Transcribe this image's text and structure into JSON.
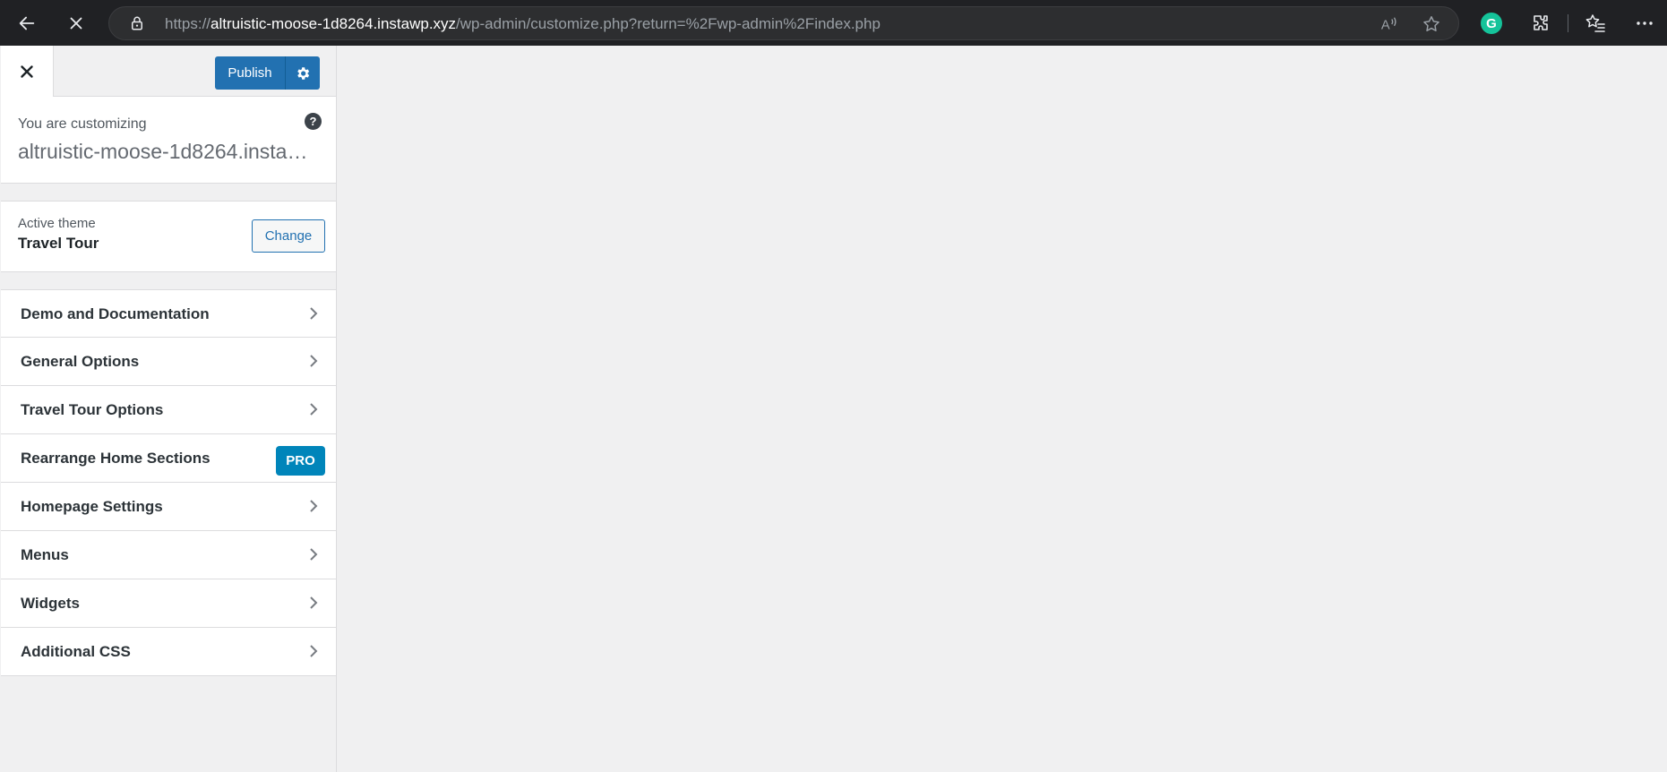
{
  "browser": {
    "url_scheme": "https://",
    "url_host": "altruistic-moose-1d8264.instawp.xyz",
    "url_path": "/wp-admin/customize.php?return=%2Fwp-admin%2Findex.php",
    "icons": [
      "back-icon",
      "stop-loading-icon",
      "lock-icon",
      "read-aloud-icon",
      "favorite-star-icon",
      "grammarly-icon",
      "extensions-icon",
      "favorites-icon",
      "more-icon"
    ],
    "grammarly_letter": "G"
  },
  "customizer": {
    "publish_label": "Publish",
    "customizing_label": "You are customizing",
    "site_name": "altruistic-moose-1d8264.instawp.xyz",
    "help_glyph": "?",
    "active_theme_label": "Active theme",
    "theme_name": "Travel Tour",
    "change_label": "Change",
    "menu_items": [
      {
        "label": "Demo and Documentation"
      },
      {
        "label": "General Options"
      },
      {
        "label": "Travel Tour Options"
      },
      {
        "label": "Rearrange Home Sections",
        "badge": "PRO"
      },
      {
        "label": "Homepage Settings"
      },
      {
        "label": "Menus"
      },
      {
        "label": "Widgets"
      },
      {
        "label": "Additional CSS"
      }
    ]
  },
  "colors": {
    "primary_blue": "#2271b1",
    "pro_badge": "#0085ba",
    "chrome_bg": "#202124",
    "panel_bg": "#f0f0f1"
  }
}
